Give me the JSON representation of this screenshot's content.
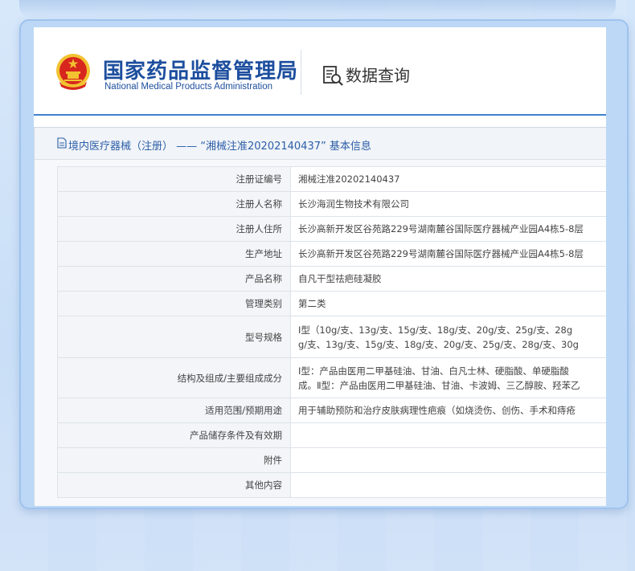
{
  "header": {
    "title_cn": "国家药品监督管理局",
    "title_en": "National Medical Products Administration",
    "query_label": "数据查询"
  },
  "panel": {
    "title": "境内医疗器械（注册） —— “湘械注准20202140437” 基本信息"
  },
  "rows": [
    {
      "label": "注册证编号",
      "lines": [
        "湘械注准20202140437"
      ]
    },
    {
      "label": "注册人名称",
      "lines": [
        "长沙海润生物技术有限公司"
      ]
    },
    {
      "label": "注册人住所",
      "lines": [
        "长沙高新开发区谷苑路229号湖南麓谷国际医疗器械产业园A4栋5-8层"
      ]
    },
    {
      "label": "生产地址",
      "lines": [
        "长沙高新开发区谷苑路229号湖南麓谷国际医疗器械产业园A4栋5-8层"
      ]
    },
    {
      "label": "产品名称",
      "lines": [
        "自凡干型祛疤硅凝胶"
      ]
    },
    {
      "label": "管理类别",
      "lines": [
        "第二类"
      ]
    },
    {
      "label": "型号规格",
      "lines": [
        "Ⅰ型（10g/支、13g/支、15g/支、18g/支、20g/支、25g/支、28g",
        "g/支、13g/支、15g/支、18g/支、20g/支、25g/支、28g/支、30g"
      ]
    },
    {
      "label": "结构及组成/主要组成成分",
      "lines": [
        "Ⅰ型：产品由医用二甲基硅油、甘油、白凡士林、硬脂酸、单硬脂酸",
        "成。Ⅱ型：产品由医用二甲基硅油、甘油、卡波姆、三乙醇胺、羟苯乙"
      ]
    },
    {
      "label": "适用范围/预期用途",
      "lines": [
        "用于辅助预防和治疗皮肤病理性疤痕（如烧烫伤、创伤、手术和痔疮"
      ]
    },
    {
      "label": "产品储存条件及有效期",
      "lines": [
        ""
      ]
    },
    {
      "label": "附件",
      "lines": [
        ""
      ]
    },
    {
      "label": "其他内容",
      "lines": [
        ""
      ]
    }
  ],
  "colors": {
    "brand_blue": "#1d4e9e",
    "accent_blue": "#3f80d0",
    "emblem_red": "#d7261e",
    "emblem_gold": "#f2c230"
  }
}
